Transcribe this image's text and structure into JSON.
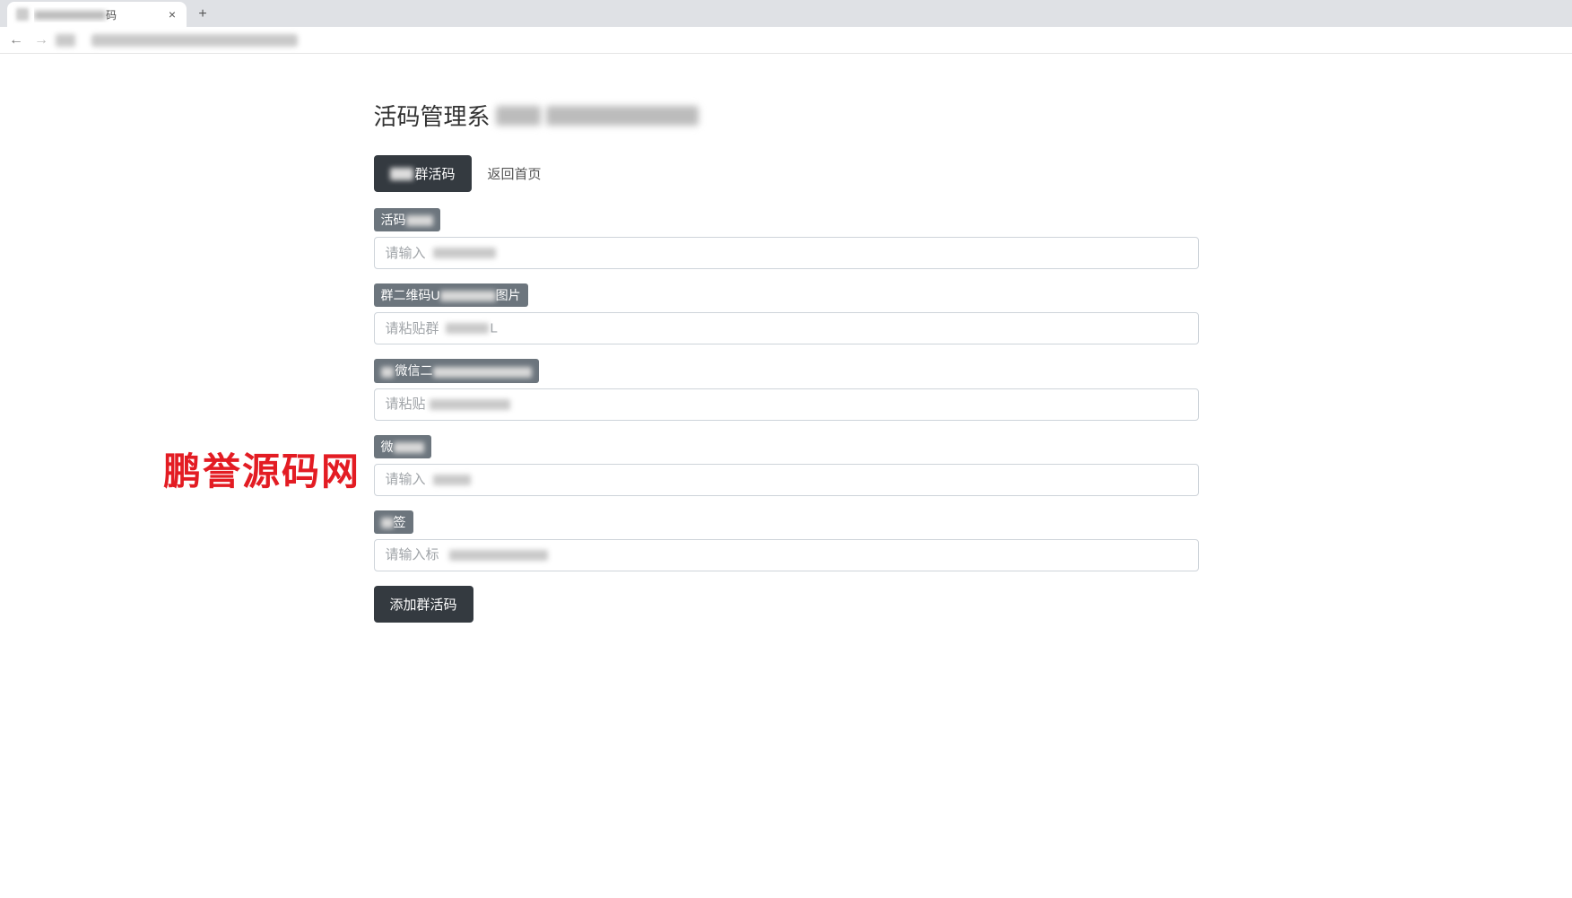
{
  "browser": {
    "tab_title_suffix": "码",
    "close_glyph": "×",
    "new_tab_glyph": "+",
    "back_glyph": "←",
    "forward_glyph": "→"
  },
  "page": {
    "title_prefix": "活码管理系"
  },
  "nav": {
    "tab_active_suffix": "群活码",
    "tab_return": "返回首页"
  },
  "form": {
    "field1": {
      "label_prefix": "活码",
      "placeholder_prefix": "请输入"
    },
    "field2": {
      "label_prefix": "群二维码U",
      "label_suffix": "图片",
      "placeholder_prefix": "请粘贴群",
      "placeholder_suffix": "L"
    },
    "field3": {
      "label_prefix": "微信二",
      "placeholder_prefix": "请粘贴"
    },
    "field4": {
      "label_prefix": "微",
      "placeholder_prefix": "请输入"
    },
    "field5": {
      "label_suffix": "签",
      "placeholder_prefix": "请输入标"
    },
    "submit": "添加群活码"
  },
  "watermark": "鹏誉源码网"
}
